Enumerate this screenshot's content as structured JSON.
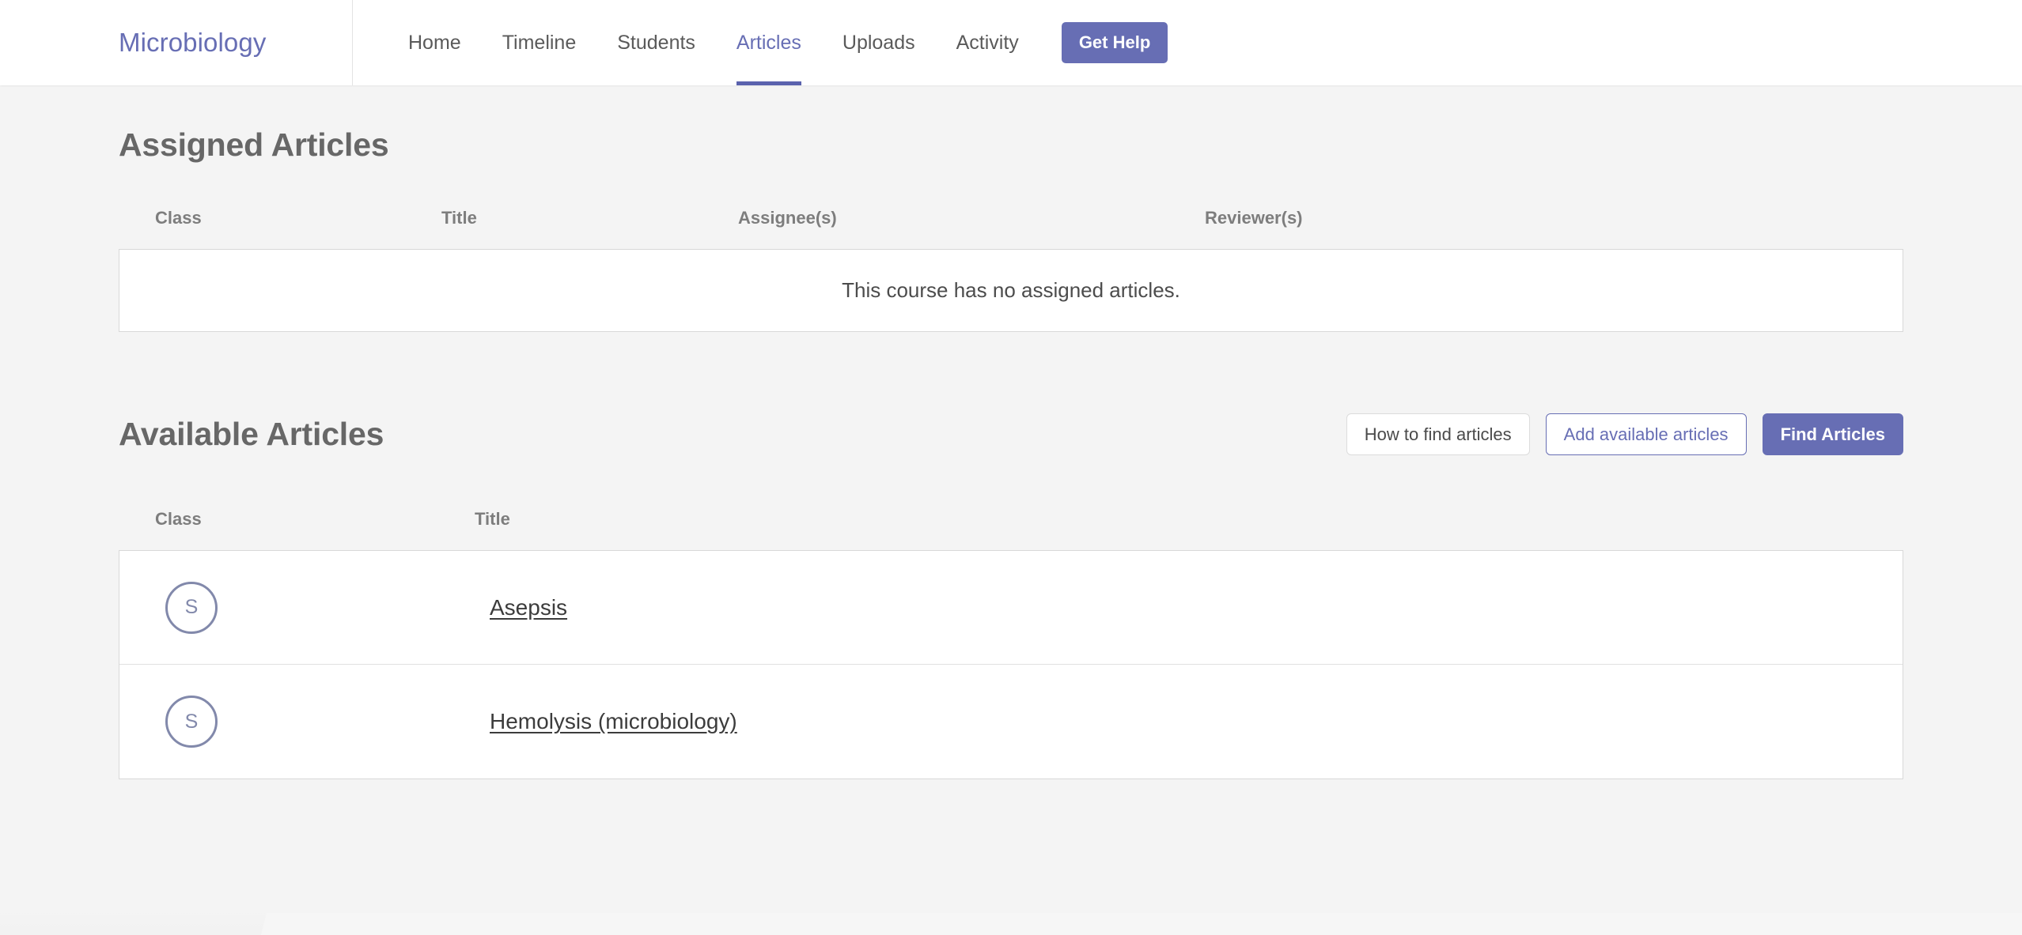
{
  "navbar": {
    "brand": "Microbiology",
    "links": [
      {
        "label": "Home",
        "active": false
      },
      {
        "label": "Timeline",
        "active": false
      },
      {
        "label": "Students",
        "active": false
      },
      {
        "label": "Articles",
        "active": true
      },
      {
        "label": "Uploads",
        "active": false
      },
      {
        "label": "Activity",
        "active": false
      }
    ],
    "get_help_label": "Get Help",
    "brand_color": "#676eb4",
    "active_underline_color": "#5a62ad"
  },
  "assigned": {
    "title": "Assigned Articles",
    "columns": [
      "Class",
      "Title",
      "Assignee(s)",
      "Reviewer(s)"
    ],
    "empty_message": "This course has no assigned articles."
  },
  "available": {
    "title": "Available Articles",
    "buttons": {
      "how_to": "How to find articles",
      "add_available": "Add available articles",
      "find": "Find Articles"
    },
    "columns": [
      "Class",
      "Title"
    ],
    "rows": [
      {
        "class_badge": "S",
        "title": "Asepsis"
      },
      {
        "class_badge": "S",
        "title": "Hemolysis (microbiology)"
      }
    ]
  },
  "colors": {
    "page_background": "#f4f4f4",
    "accent": "#676eb4",
    "badge_outline": "#8289ab",
    "heading_text": "#676767",
    "table_border": "#d8d8d8"
  }
}
